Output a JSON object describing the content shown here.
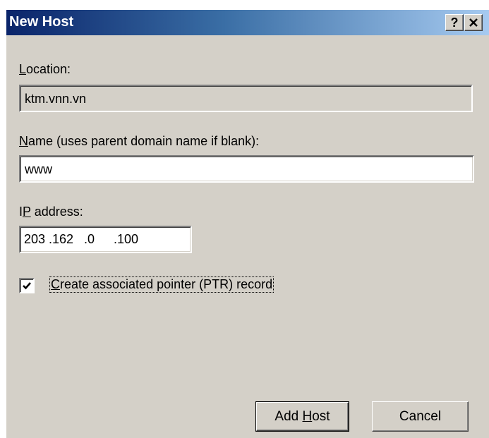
{
  "dialog": {
    "title": "New Host",
    "help_button": "?",
    "close_button": "✕"
  },
  "location": {
    "label_mnemonic": "L",
    "label_rest": "ocation:",
    "value": "ktm.vnn.vn"
  },
  "name": {
    "label_mnemonic": "N",
    "label_rest": "ame (uses parent domain name if blank):",
    "value": "www"
  },
  "ip": {
    "label_pre": "I",
    "label_mnemonic": "P",
    "label_rest": " address:",
    "octets": [
      "203",
      ".162",
      ".0",
      ".100"
    ]
  },
  "ptr": {
    "checked": true,
    "label_mnemonic": "C",
    "label_rest": "reate associated pointer (PTR) record"
  },
  "buttons": {
    "add_pre": "Add ",
    "add_mnemonic": "H",
    "add_rest": "ost",
    "cancel": "Cancel"
  }
}
